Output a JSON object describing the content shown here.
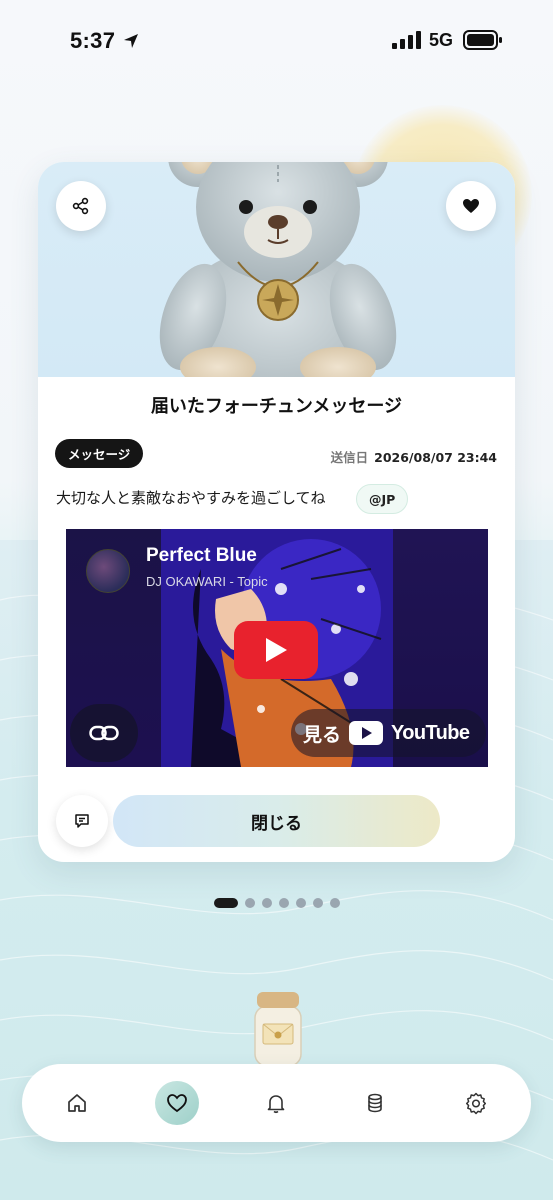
{
  "status_bar": {
    "time": "5:37",
    "network": "5G"
  },
  "card": {
    "title": "届いたフォーチュンメッセージ",
    "badge": "メッセージ",
    "sent_label": "送信日",
    "sent_datetime": "2026/08/07 23:44",
    "message": "大切な人と素敵なおやすみを過ごしてね",
    "tag": "@JP",
    "video": {
      "title": "Perfect Blue",
      "channel": "DJ OKAWARI - Topic",
      "watch_label": "見る",
      "platform": "YouTube"
    },
    "close_label": "閉じる"
  },
  "pagination": {
    "total": 7,
    "active": 1
  },
  "nav": {
    "items": [
      {
        "name": "home",
        "icon": "home-icon"
      },
      {
        "name": "favorites",
        "icon": "heart-icon",
        "active": true
      },
      {
        "name": "notifications",
        "icon": "bell-icon"
      },
      {
        "name": "database",
        "icon": "database-icon"
      },
      {
        "name": "settings",
        "icon": "gear-icon"
      }
    ]
  },
  "colors": {
    "accent": "#9ed0c9",
    "youtube_red": "#e8222d",
    "badge_bg": "#151515"
  }
}
